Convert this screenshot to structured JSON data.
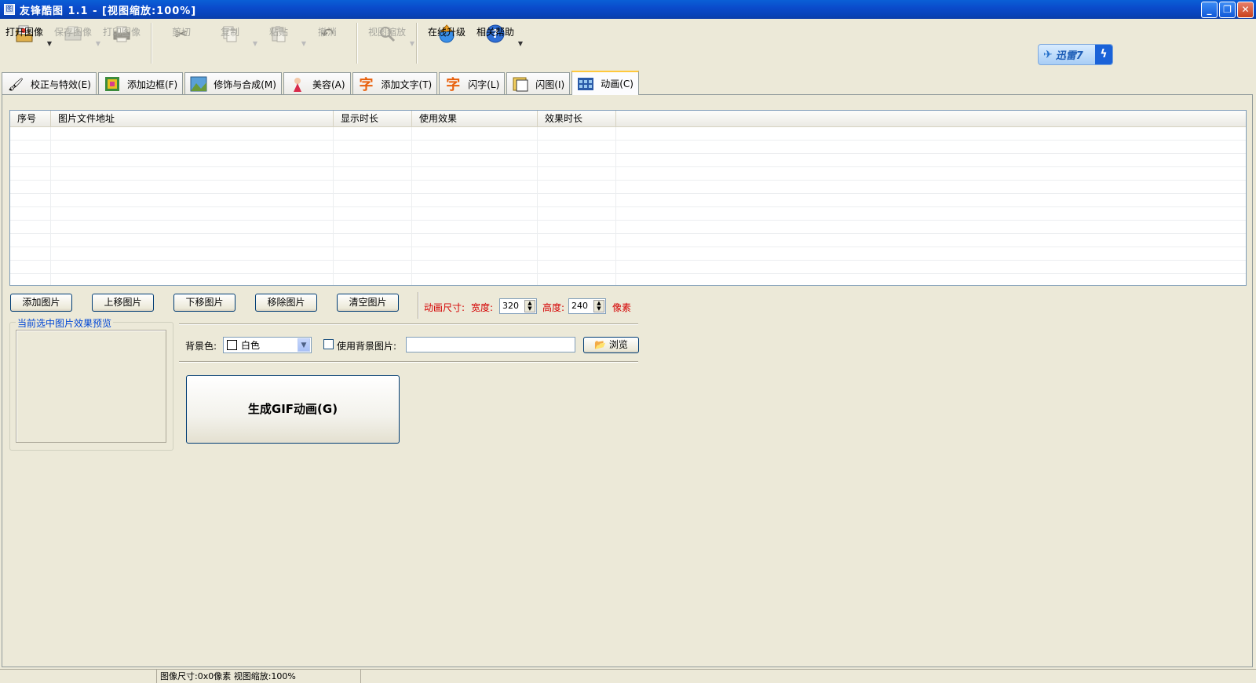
{
  "window": {
    "title": "友锋酷图  1.1 - [视图缩放:100%]"
  },
  "toolbar": [
    {
      "label": "打开图像",
      "icon": "open-image-icon",
      "enabled": true,
      "dropdown": true
    },
    {
      "label": "保存图像",
      "icon": "save-image-icon",
      "enabled": false,
      "dropdown": true
    },
    {
      "label": "打印图像",
      "icon": "print-icon",
      "enabled": false,
      "dropdown": false
    },
    {
      "label": "剪切",
      "icon": "cut-icon",
      "enabled": false,
      "dropdown": false
    },
    {
      "label": "复制",
      "icon": "copy-icon",
      "enabled": false,
      "dropdown": true
    },
    {
      "label": "粘贴",
      "icon": "paste-icon",
      "enabled": false,
      "dropdown": true
    },
    {
      "label": "撤消",
      "icon": "undo-icon",
      "enabled": false,
      "dropdown": false
    },
    {
      "label": "视图缩放",
      "icon": "zoom-icon",
      "enabled": false,
      "dropdown": true
    },
    {
      "label": "在线升级",
      "icon": "upgrade-icon",
      "enabled": true,
      "dropdown": false
    },
    {
      "label": "相关帮助",
      "icon": "help-icon",
      "enabled": true,
      "dropdown": true
    }
  ],
  "ad": {
    "label": "迅雷7"
  },
  "tabs": [
    {
      "label": "校正与特效(E)",
      "icon": "correction-effects-icon"
    },
    {
      "label": "添加边框(F)",
      "icon": "frame-icon"
    },
    {
      "label": "修饰与合成(M)",
      "icon": "compose-icon"
    },
    {
      "label": "美容(A)",
      "icon": "beauty-icon"
    },
    {
      "label": "添加文字(T)",
      "icon": "text-icon"
    },
    {
      "label": "闪字(L)",
      "icon": "flash-text-icon"
    },
    {
      "label": "闪图(I)",
      "icon": "flash-image-icon"
    },
    {
      "label": "动画(C)",
      "icon": "animation-icon",
      "active": true
    }
  ],
  "table": {
    "headers": [
      "序号",
      "图片文件地址",
      "显示时长",
      "使用效果",
      "效果时长"
    ],
    "rows": []
  },
  "actions": {
    "add": "添加图片",
    "up": "上移图片",
    "down": "下移图片",
    "remove": "移除图片",
    "clear": "清空图片"
  },
  "size": {
    "label": "动画尺寸:",
    "width_label": "宽度:",
    "width": "320",
    "height_label": "高度:",
    "height": "240",
    "unit": "像素",
    "color": "#d40000"
  },
  "preview": {
    "title": "当前选中图片效果预览"
  },
  "background": {
    "color_label": "背景色:",
    "color_value": "白色",
    "use_image_label": "使用背景图片:",
    "image_path": "",
    "browse_label": "浏览"
  },
  "generate_label": "生成GIF动画(G)",
  "status": {
    "text": "图像尺寸:0x0像素 视图缩放:100%"
  }
}
